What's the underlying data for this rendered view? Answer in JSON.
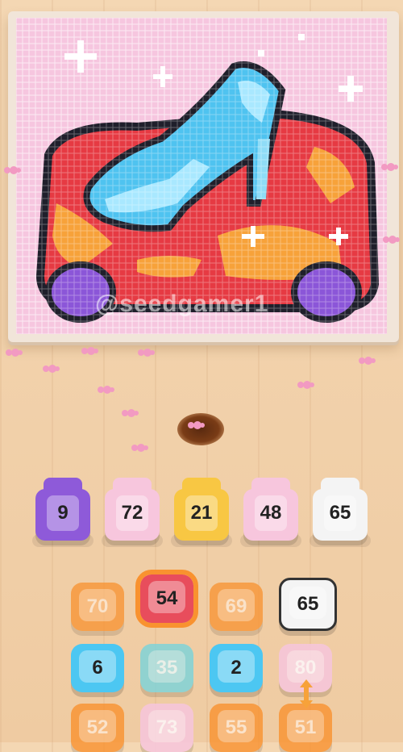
{
  "watermark": "@seedgamer1",
  "palette": {
    "bg_pink": "#f6c6df",
    "light_pink": "#fbe3ef",
    "white": "#ffffff",
    "outline": "#1f1f2b",
    "red": "#e63a43",
    "orange": "#f7a23a",
    "blue": "#4fc3f0",
    "light_blue": "#a9e8ff",
    "purple": "#8b56d8",
    "slot_purple": "#8e5ad9",
    "slot_pink": "#f7c6dd",
    "slot_yellow": "#f8c743",
    "slot_white": "#f4f4f4",
    "tile_orange": "#f9922f",
    "tile_red": "#e84d5c",
    "tile_blue": "#4cc7f2",
    "tile_teal": "#79d4dc",
    "ant_pink": "#f29ac2"
  },
  "slots": [
    {
      "label": "9",
      "color": "#8e5ad9"
    },
    {
      "label": "72",
      "color": "#f7c6dd"
    },
    {
      "label": "21",
      "color": "#f8c743"
    },
    {
      "label": "48",
      "color": "#f7c6dd"
    },
    {
      "label": "65",
      "color": "#f4f4f4"
    }
  ],
  "tiles": [
    {
      "label": "70",
      "color": "#f9922f",
      "faded": true
    },
    {
      "label": "54",
      "color": "#e84d5c",
      "faded": false
    },
    {
      "label": "69",
      "color": "#f9922f",
      "faded": true
    },
    {
      "label": "65",
      "color": "#f4f4f4",
      "faded": false
    },
    {
      "label": "6",
      "color": "#4cc7f2",
      "faded": false
    },
    {
      "label": "35",
      "color": "#79d4dc",
      "faded": true
    },
    {
      "label": "2",
      "color": "#4cc7f2",
      "faded": false
    },
    {
      "label": "80",
      "color": "#f7c6dd",
      "faded": true
    },
    {
      "label": "52",
      "color": "#f9922f",
      "faded": true
    },
    {
      "label": "73",
      "color": "#f7c6dd",
      "faded": true
    },
    {
      "label": "55",
      "color": "#f9922f",
      "faded": true
    },
    {
      "label": "51",
      "color": "#f9922f",
      "faded": true
    }
  ]
}
